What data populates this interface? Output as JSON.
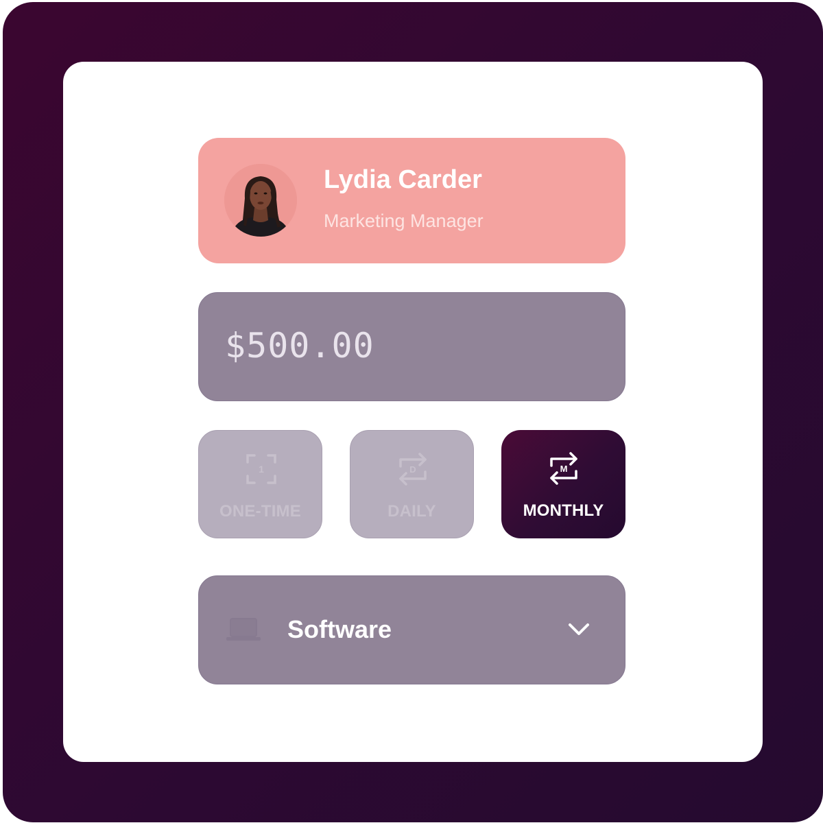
{
  "profile": {
    "name": "Lydia Carder",
    "role": "Marketing Manager",
    "avatar_icon": "person-photo-icon"
  },
  "amount": {
    "value": "$500.00"
  },
  "frequency": {
    "options": [
      {
        "label": "ONE-TIME",
        "icon": "one-time-icon",
        "selected": false
      },
      {
        "label": "DAILY",
        "icon": "daily-repeat-icon",
        "selected": false
      },
      {
        "label": "MONTHLY",
        "icon": "monthly-repeat-icon",
        "selected": true
      }
    ],
    "icon_letters": {
      "one_time": "1",
      "daily": "D",
      "monthly": "M"
    }
  },
  "category": {
    "selected": "Software",
    "icon": "laptop-icon",
    "dropdown_icon": "chevron-down-icon"
  },
  "colors": {
    "frame": "#2d0932",
    "profile_card": "#f4a3a0",
    "input_bg": "#918498",
    "inactive_option": "#b6aebd",
    "active_option": "#3a0b35"
  }
}
